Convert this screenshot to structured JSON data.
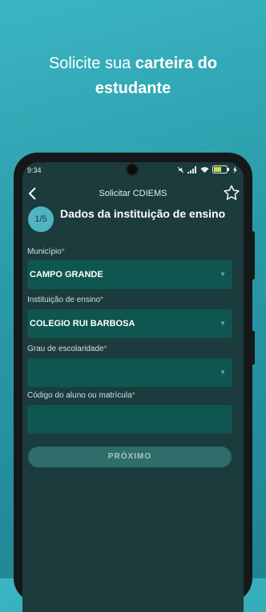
{
  "promo": {
    "line1_regular": "Solicite sua ",
    "line1_bold": "carteira do",
    "line2_bold": "estudante"
  },
  "status_bar": {
    "time": "9:34",
    "battery": "51"
  },
  "app_bar": {
    "title": "Solicitar CDIEMS"
  },
  "step": {
    "indicator": "1/5",
    "title": "Dados da instituição de ensino"
  },
  "form": {
    "municipio": {
      "label": "Município",
      "required_mark": "*",
      "value": "CAMPO GRANDE"
    },
    "instituicao": {
      "label": "Instituição de ensino",
      "required_mark": "*",
      "value": "COLEGIO RUI BARBOSA"
    },
    "grau": {
      "label": "Grau de escolaridade",
      "required_mark": "*",
      "value": ""
    },
    "codigo": {
      "label": "Código do aluno ou matrícula",
      "required_mark": "*",
      "value": ""
    }
  },
  "actions": {
    "next_label": "PRÓXIMO"
  },
  "colors": {
    "background": "#2a9aa8",
    "screen": "#1b3b3d",
    "field": "#0f5550",
    "accent": "#4fb4c0",
    "required": "#e5a25a"
  }
}
